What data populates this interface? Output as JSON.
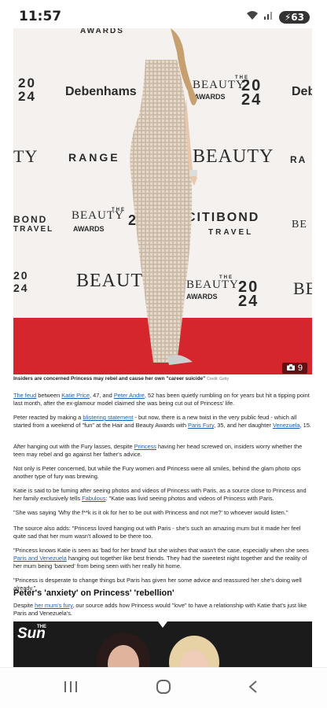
{
  "status_bar": {
    "time": "11:57",
    "battery": "63"
  },
  "hero": {
    "wall_texts": [
      "AWARDS",
      "20",
      "24",
      "Debenhams",
      "THE",
      "BEAUTY",
      "AWARDS",
      "20",
      "24",
      "Deb",
      "TY",
      "RANGE",
      "BEAUTY",
      "RA",
      "BOND",
      "TRAVEL",
      "BEAUTY",
      "AWARDS",
      "THE",
      "2",
      "CITIBOND",
      "TRAVEL",
      "BE",
      "20",
      "24",
      "BEAUTY",
      "THE",
      "BEAUTY",
      "AWARDS",
      "20",
      "24",
      "BE"
    ],
    "photo_count": "9"
  },
  "caption": {
    "text": "Insiders are concerned Princess may rebel and cause her own \"career suicide\"",
    "credit": "Credit: Getty"
  },
  "paragraphs": {
    "p1": {
      "link1": "The feud",
      "t1": " between ",
      "link2": "Katie Price",
      "t2": ", 47, and ",
      "link3": "Peter Andre",
      "t3": ", 52 has been quietly rumbling on for years but hit a tipping point last month, after the ex-glamour model claimed she was being cut out of Princess' life."
    },
    "p2": {
      "t1": "Peter reacted by making a ",
      "link1": "blistering statement",
      "t2": " - but now, there is a new twist in the very public feud - which all started from a weekend of \"fun\" at the Hair and Beauty Awards with ",
      "link2": "Paris Fury",
      "t3": ", 35, and her daughter ",
      "link3": "Venezuela",
      "t4": ", 15."
    },
    "p3": {
      "t1": "After hanging out with the Fury lasses, despite ",
      "link1": "Princess",
      "t2": " having her head screwed on, insiders worry whether the teen may rebel and go against her father's advice."
    },
    "p4": "Not only is Peter concerned, but while the Fury women and Princess were all smiles, behind the glam photo ops another type of fury was brewing.",
    "p5": {
      "t1": "Katie is said to be fuming after seeing photos and videos of Princess with Paris, as a source close to Princess and her family exclusively tells ",
      "link1": "Fabulous",
      "t2": ": \"Katie was livid seeing photos and videos of Princess with Paris."
    },
    "p6": "\"She was saying 'Why the f**k is it ok for her to be out with Princess and not me?' to whoever would listen.\"",
    "p7": "The source also adds: \"Princess loved hanging out with Paris - she's such an amazing mum but it made her feel quite sad that her mum wasn't allowed to be there too.",
    "p8": {
      "t1": "\"Princess knows Katie is seen as 'bad for her brand' but she wishes that wasn't the case, especially when she sees ",
      "link1": "Paris and Venezuela",
      "t2": " hanging out together like best friends. They had the sweetest night together and the reality of her mum being 'banned' from being seen with her really hit home."
    },
    "p9": "\"Princess is desperate to change things but Paris has given her some advice and reassured her she's doing well already.\"",
    "p10": {
      "t1": "Despite ",
      "link1": "her mum's fury",
      "t2": ", our source adds how Princess would \"love\" to have a relationship with Katie that's just like Paris and Venezuela's."
    }
  },
  "heading": "Peter's 'anxiety' on Princess' 'rebellion'",
  "promo": {
    "logo": "Sun",
    "logo_prefix": "THE"
  },
  "colors": {
    "link": "#1a5fb4",
    "carpet": "#d4262c",
    "promo_bg": "#1b1b1b"
  }
}
